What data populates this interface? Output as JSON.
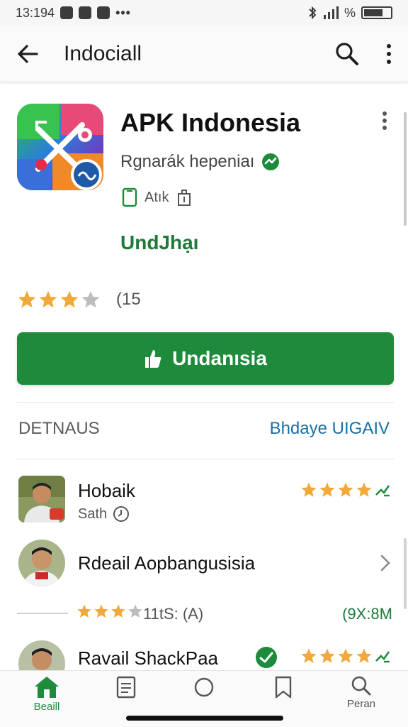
{
  "status": {
    "time": "13:194",
    "percent": "%"
  },
  "app_bar": {
    "title": "Indociall"
  },
  "app": {
    "name": "APK Indonesia",
    "developer": "Rgnarák hepeniaı",
    "meta_label": "Atık",
    "install_link": "UndJhạı",
    "rating_count": "(15",
    "rating_stars": 3,
    "install_button": "Undanısia"
  },
  "section": {
    "title": "DETNAUS",
    "link": "Bhdaye UIGAIV"
  },
  "reviews": [
    {
      "name": "Hobaik",
      "sub": "Sath",
      "stars": 4
    },
    {
      "name": "Rdeail Aopbangusisia"
    },
    {
      "name": "Ravail ShackPaa",
      "stars": 4
    }
  ],
  "rating_summary": {
    "value": "11tS: (A)",
    "stars": 3,
    "size": "(9X:8M"
  },
  "nav": {
    "home": "Beaill",
    "search": "Peran"
  },
  "colors": {
    "accent_green": "#1e8a3c",
    "link_blue": "#1a6fa3",
    "star_gold": "#f2a93b",
    "star_gray": "#bdbdbd"
  }
}
